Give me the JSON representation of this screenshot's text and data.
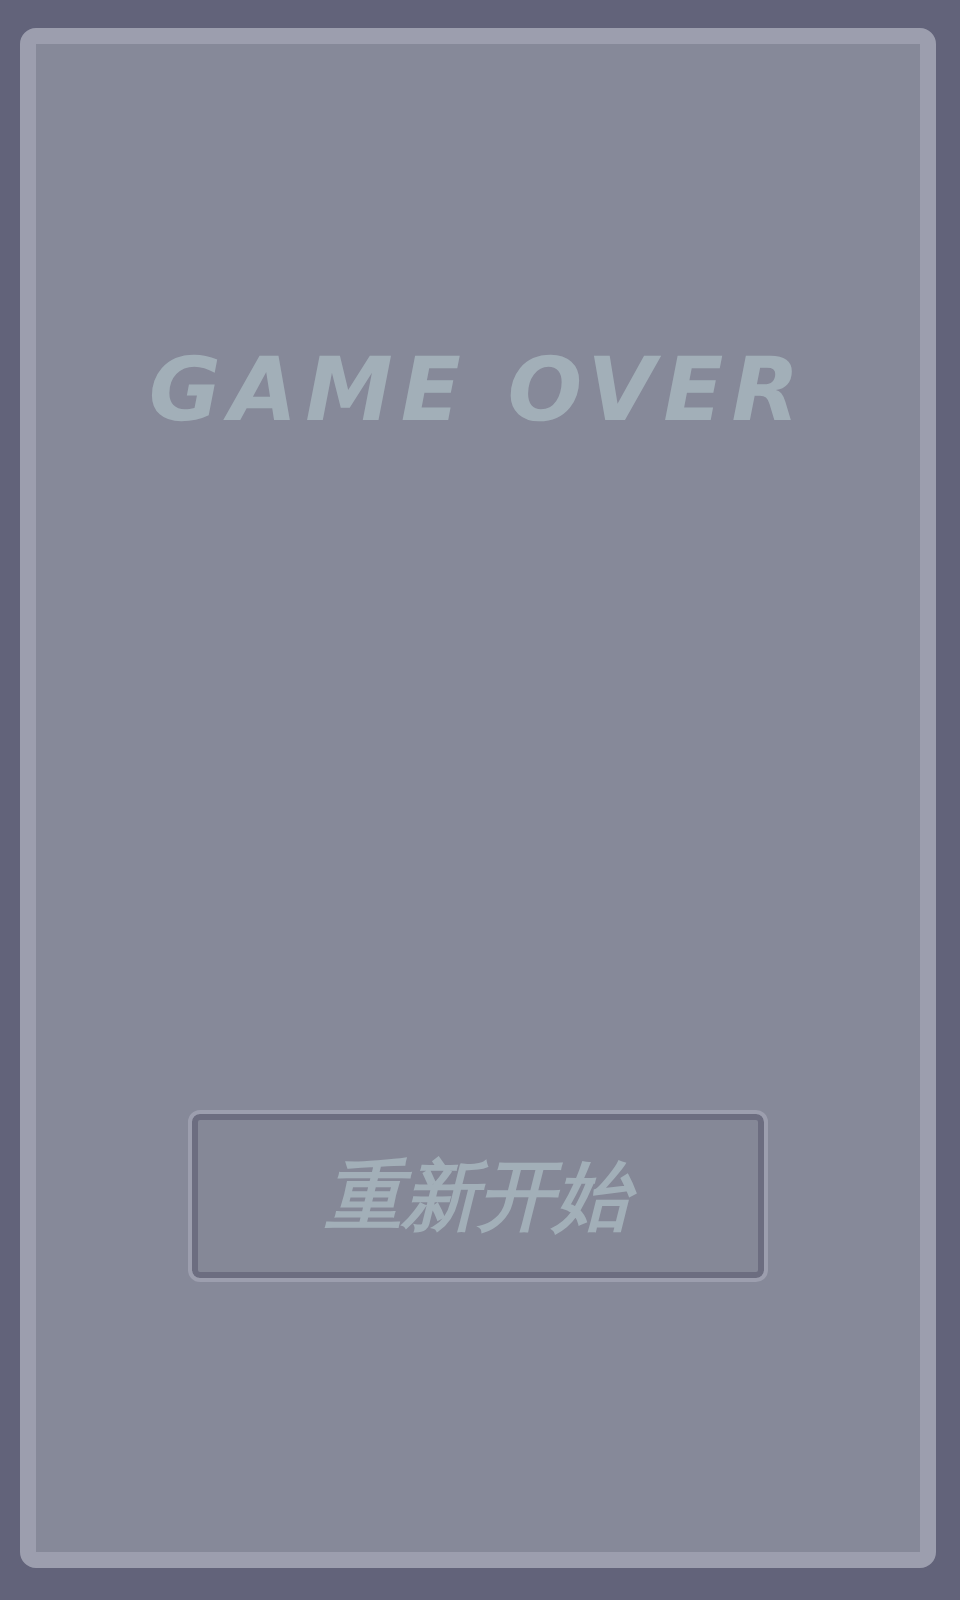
{
  "title": "GAME OVER",
  "restart_button": {
    "label": "重新开始"
  }
}
